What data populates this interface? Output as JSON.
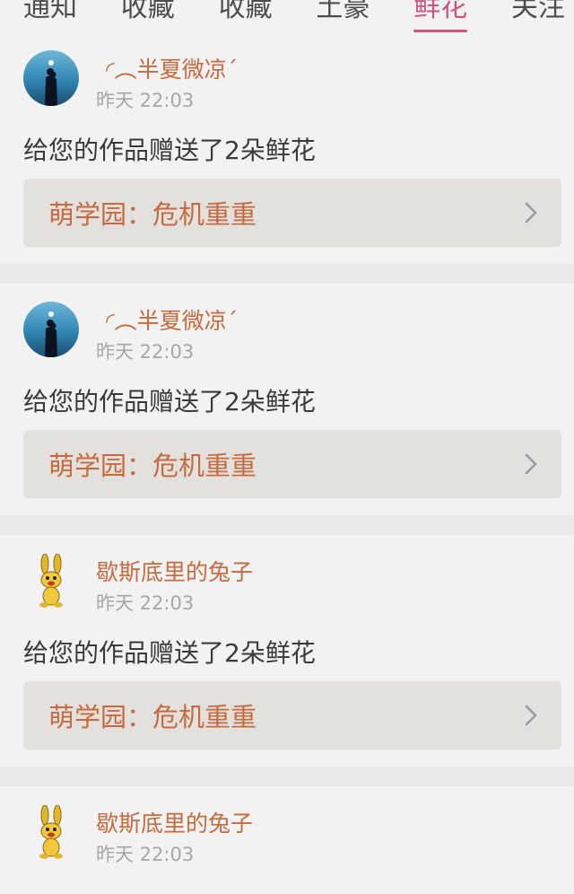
{
  "tabs": [
    {
      "label": "通知",
      "active": false
    },
    {
      "label": "收藏",
      "active": false
    },
    {
      "label": "收藏",
      "active": false
    },
    {
      "label": "土豪",
      "active": false
    },
    {
      "label": "鲜花",
      "active": true
    },
    {
      "label": "关注",
      "active": false
    }
  ],
  "feed": [
    {
      "username": "◜︵半夏微凉ˊ",
      "time": "昨天 22:03",
      "message": "给您的作品赠送了2朵鲜花",
      "work_title": "萌学园：危机重重",
      "avatar": "couple-silhouette"
    },
    {
      "username": "◜︵半夏微凉ˊ",
      "time": "昨天 22:03",
      "message": "给您的作品赠送了2朵鲜花",
      "work_title": "萌学园：危机重重",
      "avatar": "couple-silhouette"
    },
    {
      "username": "歇斯底里的兔子",
      "time": "昨天 22:03",
      "message": "给您的作品赠送了2朵鲜花",
      "work_title": "萌学园：危机重重",
      "avatar": "yellow-rabbit"
    },
    {
      "username": "歇斯底里的兔子",
      "time": "昨天 22:03",
      "avatar": "yellow-rabbit"
    }
  ],
  "colors": {
    "accent": "#d0527f",
    "name": "#c8693e",
    "background": "#e9e9e9",
    "card": "#f2f2f2",
    "link_bg": "#e2e1dd"
  }
}
